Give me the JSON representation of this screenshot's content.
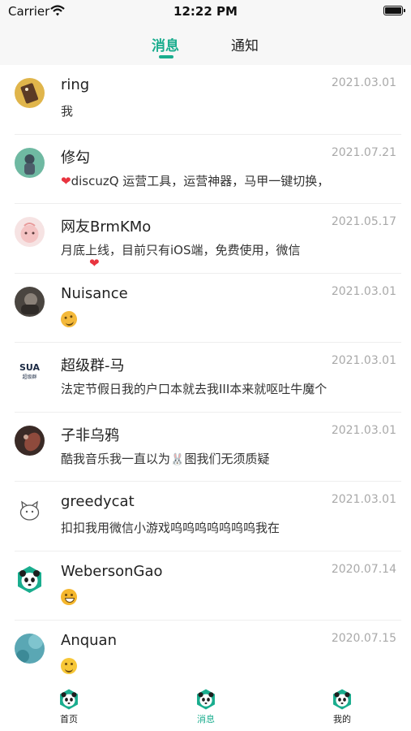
{
  "status_bar": {
    "carrier": "Carrier",
    "time": "12:22 PM"
  },
  "header": {
    "tabs": [
      {
        "label": "消息",
        "active": true
      },
      {
        "label": "通知",
        "active": false
      }
    ]
  },
  "conversations": [
    {
      "name": "ring",
      "date": "2021.03.01",
      "preview": "我"
    },
    {
      "name": "修勾",
      "date": "2021.07.21",
      "preview": "discuzQ 运营工具，运营神器，马甲一键切换，",
      "preview_icon": "heart-icon"
    },
    {
      "name": "网友BrmKMo",
      "date": "2021.05.17",
      "preview": "月底上线，目前只有iOS端，免费使用，微信",
      "trailing_icon": "heart-icon"
    },
    {
      "name": "Nuisance",
      "date": "2021.03.01",
      "preview": "",
      "preview_icon": "thinking-face-emoji"
    },
    {
      "name": "超级群-马",
      "date": "2021.03.01",
      "preview": "法定节假日我的户口本就去我III本来就呕吐牛魔个",
      "avatar_text": "SUA 超级群"
    },
    {
      "name": "子非乌鸦",
      "date": "2021.03.01",
      "preview_before": "酷我音乐我一直以为",
      "preview_after": "图我们无须质疑",
      "inline_icon": "bunny-emoji"
    },
    {
      "name": "greedycat",
      "date": "2021.03.01",
      "preview": "扣扣我用微信小游戏呜呜呜呜呜呜呜我在"
    },
    {
      "name": "WebersonGao",
      "date": "2020.07.14",
      "preview": "",
      "preview_icon": "grinning-face-emoji"
    },
    {
      "name": "Anquan",
      "date": "2020.07.15",
      "preview": "",
      "preview_icon": "smiling-face-emoji"
    }
  ],
  "tab_bar": {
    "items": [
      {
        "label": "首页",
        "icon": "panda-home-icon",
        "active": false
      },
      {
        "label": "消息",
        "icon": "panda-messages-icon",
        "active": true
      },
      {
        "label": "我的",
        "icon": "panda-profile-icon",
        "active": false
      }
    ]
  },
  "colors": {
    "accent": "#1aad8e",
    "date_text": "#a9a9a9",
    "nav_background": "#f7f7f7",
    "heart": "#e8343f"
  }
}
